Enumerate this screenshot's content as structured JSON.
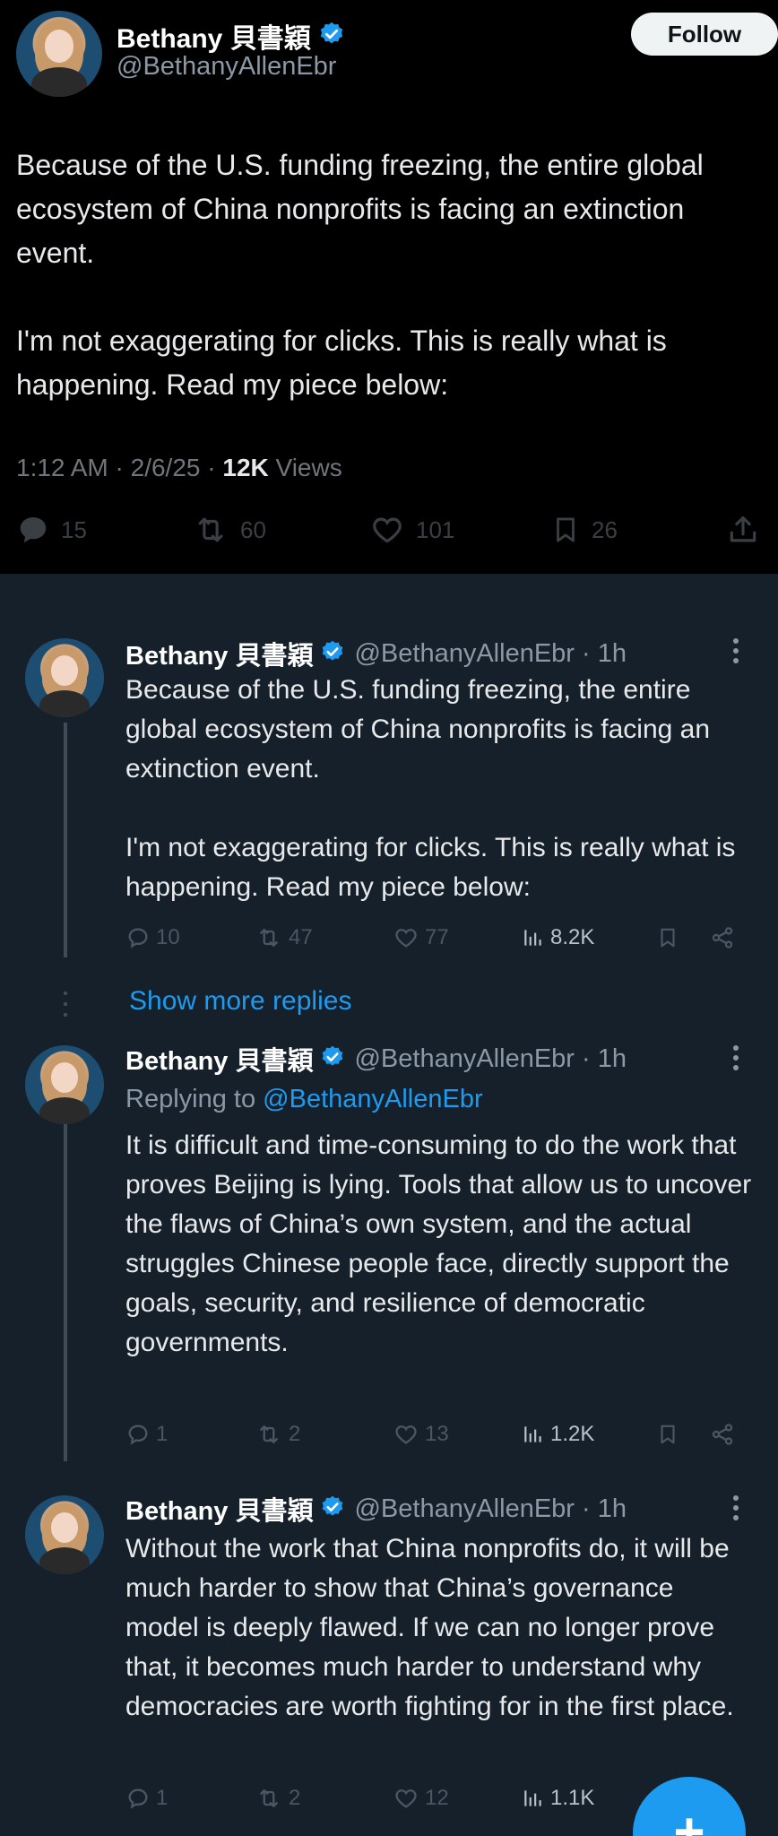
{
  "main_tweet": {
    "display_name": "Bethany 貝書穎",
    "handle": "@BethanyAllenEbr",
    "follow_label": "Follow",
    "text": "Because of the U.S. funding freezing, the entire global ecosystem of China nonprofits is facing an extinction event.\n\nI'm not exaggerating for clicks. This is really what is happening. Read my piece below:",
    "time": "1:12 AM",
    "date": "2/6/25",
    "views": "12K",
    "views_label": "Views",
    "replies": "15",
    "retweets": "60",
    "likes": "101",
    "bookmarks": "26"
  },
  "replies": [
    {
      "display_name": "Bethany 貝書穎",
      "handle": "@BethanyAllenEbr · 1h",
      "text": "Because of the U.S. funding freezing, the entire global ecosystem of China nonprofits is facing an extinction event.\n\nI'm not exaggerating for clicks. This is really what is happening. Read my piece below:",
      "replies": "10",
      "retweets": "47",
      "likes": "77",
      "views": "8.2K"
    },
    {
      "display_name": "Bethany 貝書穎",
      "handle": "@BethanyAllenEbr · 1h",
      "replying_prefix": "Replying to",
      "replying_to": "@BethanyAllenEbr",
      "text": "It is difficult and time-consuming to do the work that proves Beijing is lying. Tools that allow us to uncover the flaws of China’s own system, and the actual struggles Chinese people face, directly support the goals, security, and resilience of democratic governments.",
      "replies": "1",
      "retweets": "2",
      "likes": "13",
      "views": "1.2K"
    },
    {
      "display_name": "Bethany 貝書穎",
      "handle": "@BethanyAllenEbr · 1h",
      "text": "Without the work that China nonprofits do, it will be much harder to show that China’s governance model is deeply flawed. If we can no longer prove that, it becomes much harder to understand why democracies are worth fighting for in the first place.",
      "replies": "1",
      "retweets": "2",
      "likes": "12",
      "views": "1.1K"
    }
  ],
  "show_more_replies": "Show more replies",
  "fab_symbol": "+",
  "colors": {
    "accent": "#1d9bf0",
    "background": "#15202b",
    "top_background": "#000000",
    "muted": "#8b98a5"
  }
}
